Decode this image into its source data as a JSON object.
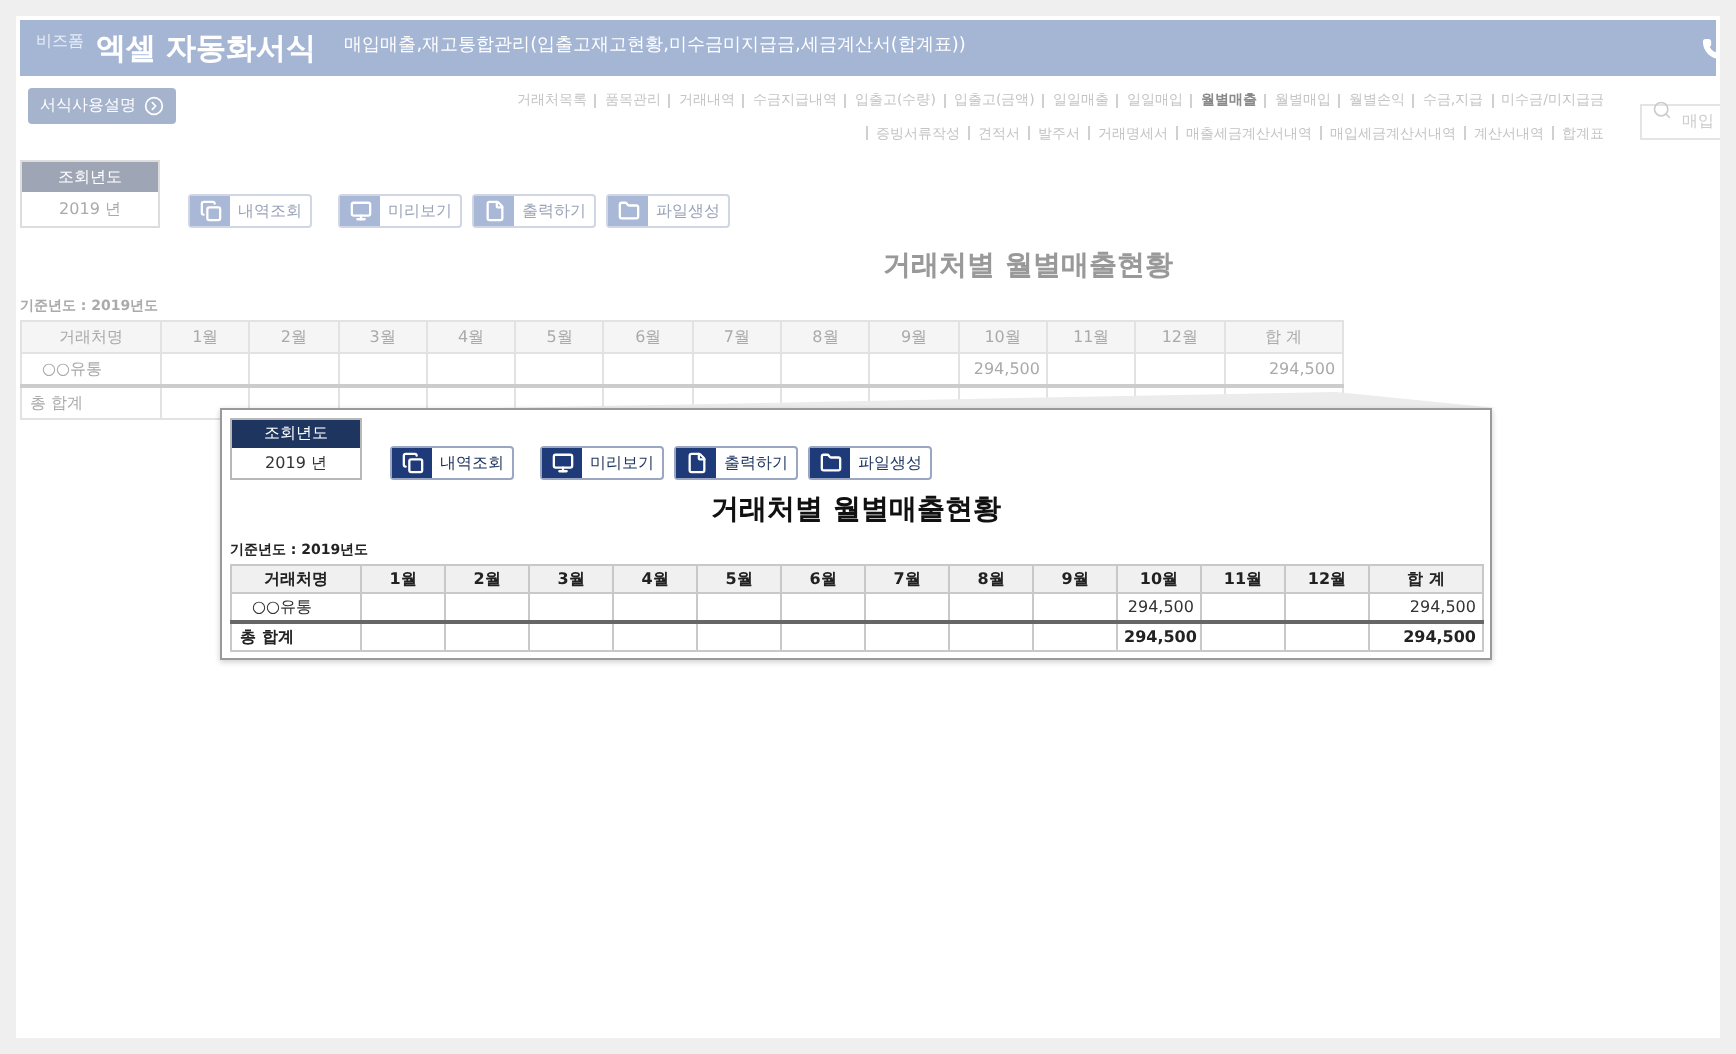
{
  "header": {
    "brand": "비즈폼",
    "title": "엑셀 자동화서식",
    "subtitle": "매입매출,재고통합관리(입출고재고현황,미수금미지급금,세금계산서(합계표))"
  },
  "guide_button": "서식사용설명",
  "nav": {
    "primary_links": [
      {
        "label": "거래처목록",
        "selected": false
      },
      {
        "label": "품목관리",
        "selected": false
      },
      {
        "label": "거래내역",
        "selected": false
      },
      {
        "label": "수금지급내역",
        "selected": false
      },
      {
        "label": "입출고(수량)",
        "selected": false
      },
      {
        "label": "입출고(금액)",
        "selected": false
      },
      {
        "label": "일일매출",
        "selected": false
      },
      {
        "label": "일일매입",
        "selected": false
      },
      {
        "label": "월별매출",
        "selected": true
      },
      {
        "label": "월별매입",
        "selected": false
      },
      {
        "label": "월별손익",
        "selected": false
      },
      {
        "label": "수금,지급",
        "selected": false
      },
      {
        "label": "미수금/미지급금",
        "selected": false
      }
    ],
    "secondary_links": [
      {
        "label": "증빙서류작성",
        "selected": false
      },
      {
        "label": "견적서",
        "selected": false
      },
      {
        "label": "발주서",
        "selected": false
      },
      {
        "label": "거래명세서",
        "selected": false
      },
      {
        "label": "매출세금계산서내역",
        "selected": false
      },
      {
        "label": "매입세금계산서내역",
        "selected": false
      },
      {
        "label": "계산서내역",
        "selected": false
      },
      {
        "label": "합계표",
        "selected": false
      }
    ]
  },
  "search": {
    "placeholder": "매입"
  },
  "background": {
    "year_label": "조회년도",
    "year_value": "2019 년",
    "buttons": [
      {
        "label": "내역조회",
        "kind": "list"
      },
      {
        "label": "미리보기",
        "kind": "monitor"
      },
      {
        "label": "출력하기",
        "kind": "print"
      },
      {
        "label": "파일생성",
        "kind": "folder"
      }
    ],
    "report_title": "거래처별 월별매출현황",
    "base_year": "기준년도 : 2019년도",
    "columns": [
      "거래처명",
      "1월",
      "2월",
      "3월",
      "4월",
      "5월",
      "6월",
      "7월",
      "8월",
      "9월",
      "10월",
      "11월",
      "12월",
      "합 계"
    ],
    "rows": [
      {
        "cells": [
          "○○유통",
          "",
          "",
          "",
          "",
          "",
          "",
          "",
          "",
          "",
          "294,500",
          "",
          "",
          "294,500"
        ]
      }
    ],
    "total": {
      "cells": [
        "총 합계"
      ]
    }
  },
  "inset": {
    "year_label": "조회년도",
    "year_value": "2019 년",
    "buttons": [
      {
        "label": "내역조회",
        "kind": "list"
      },
      {
        "label": "미리보기",
        "kind": "monitor"
      },
      {
        "label": "출력하기",
        "kind": "print"
      },
      {
        "label": "파일생성",
        "kind": "folder"
      }
    ],
    "report_title": "거래처별 월별매출현황",
    "base_year": "기준년도 : 2019년도",
    "columns": [
      "거래처명",
      "1월",
      "2월",
      "3월",
      "4월",
      "5월",
      "6월",
      "7월",
      "8월",
      "9월",
      "10월",
      "11월",
      "12월",
      "합 계"
    ],
    "rows": [
      {
        "cells": [
          "○○유통",
          "",
          "",
          "",
          "",
          "",
          "",
          "",
          "",
          "",
          "294,500",
          "",
          "",
          "294,500"
        ]
      }
    ],
    "total": {
      "cells": [
        "총 합계",
        "",
        "",
        "",
        "",
        "",
        "",
        "",
        "",
        "",
        "294,500",
        "",
        "",
        "294,500"
      ]
    }
  }
}
